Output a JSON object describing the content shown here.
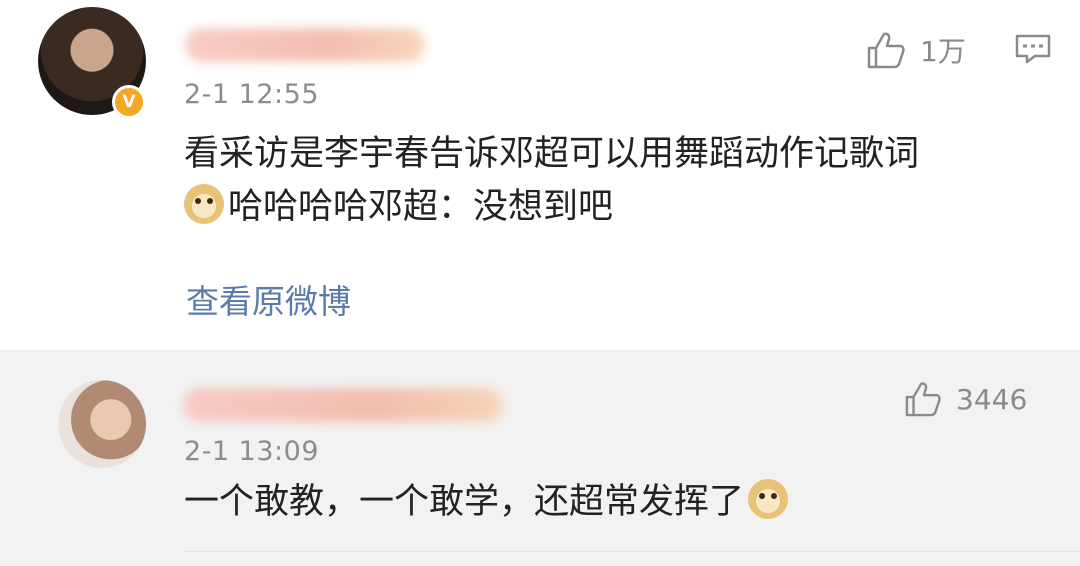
{
  "comments": [
    {
      "time": "2-1 12:55",
      "like_count": "1万",
      "text": "看采访是李宇春告诉邓超可以用舞蹈动作记歌词",
      "text_line2": "哈哈哈哈邓超：没想到吧",
      "view_original": "查看原微博",
      "badge": "V"
    },
    {
      "time": "2-1 13:09",
      "like_count": "3446",
      "text": "一个敢教，一个敢学，还超常发挥了"
    }
  ]
}
